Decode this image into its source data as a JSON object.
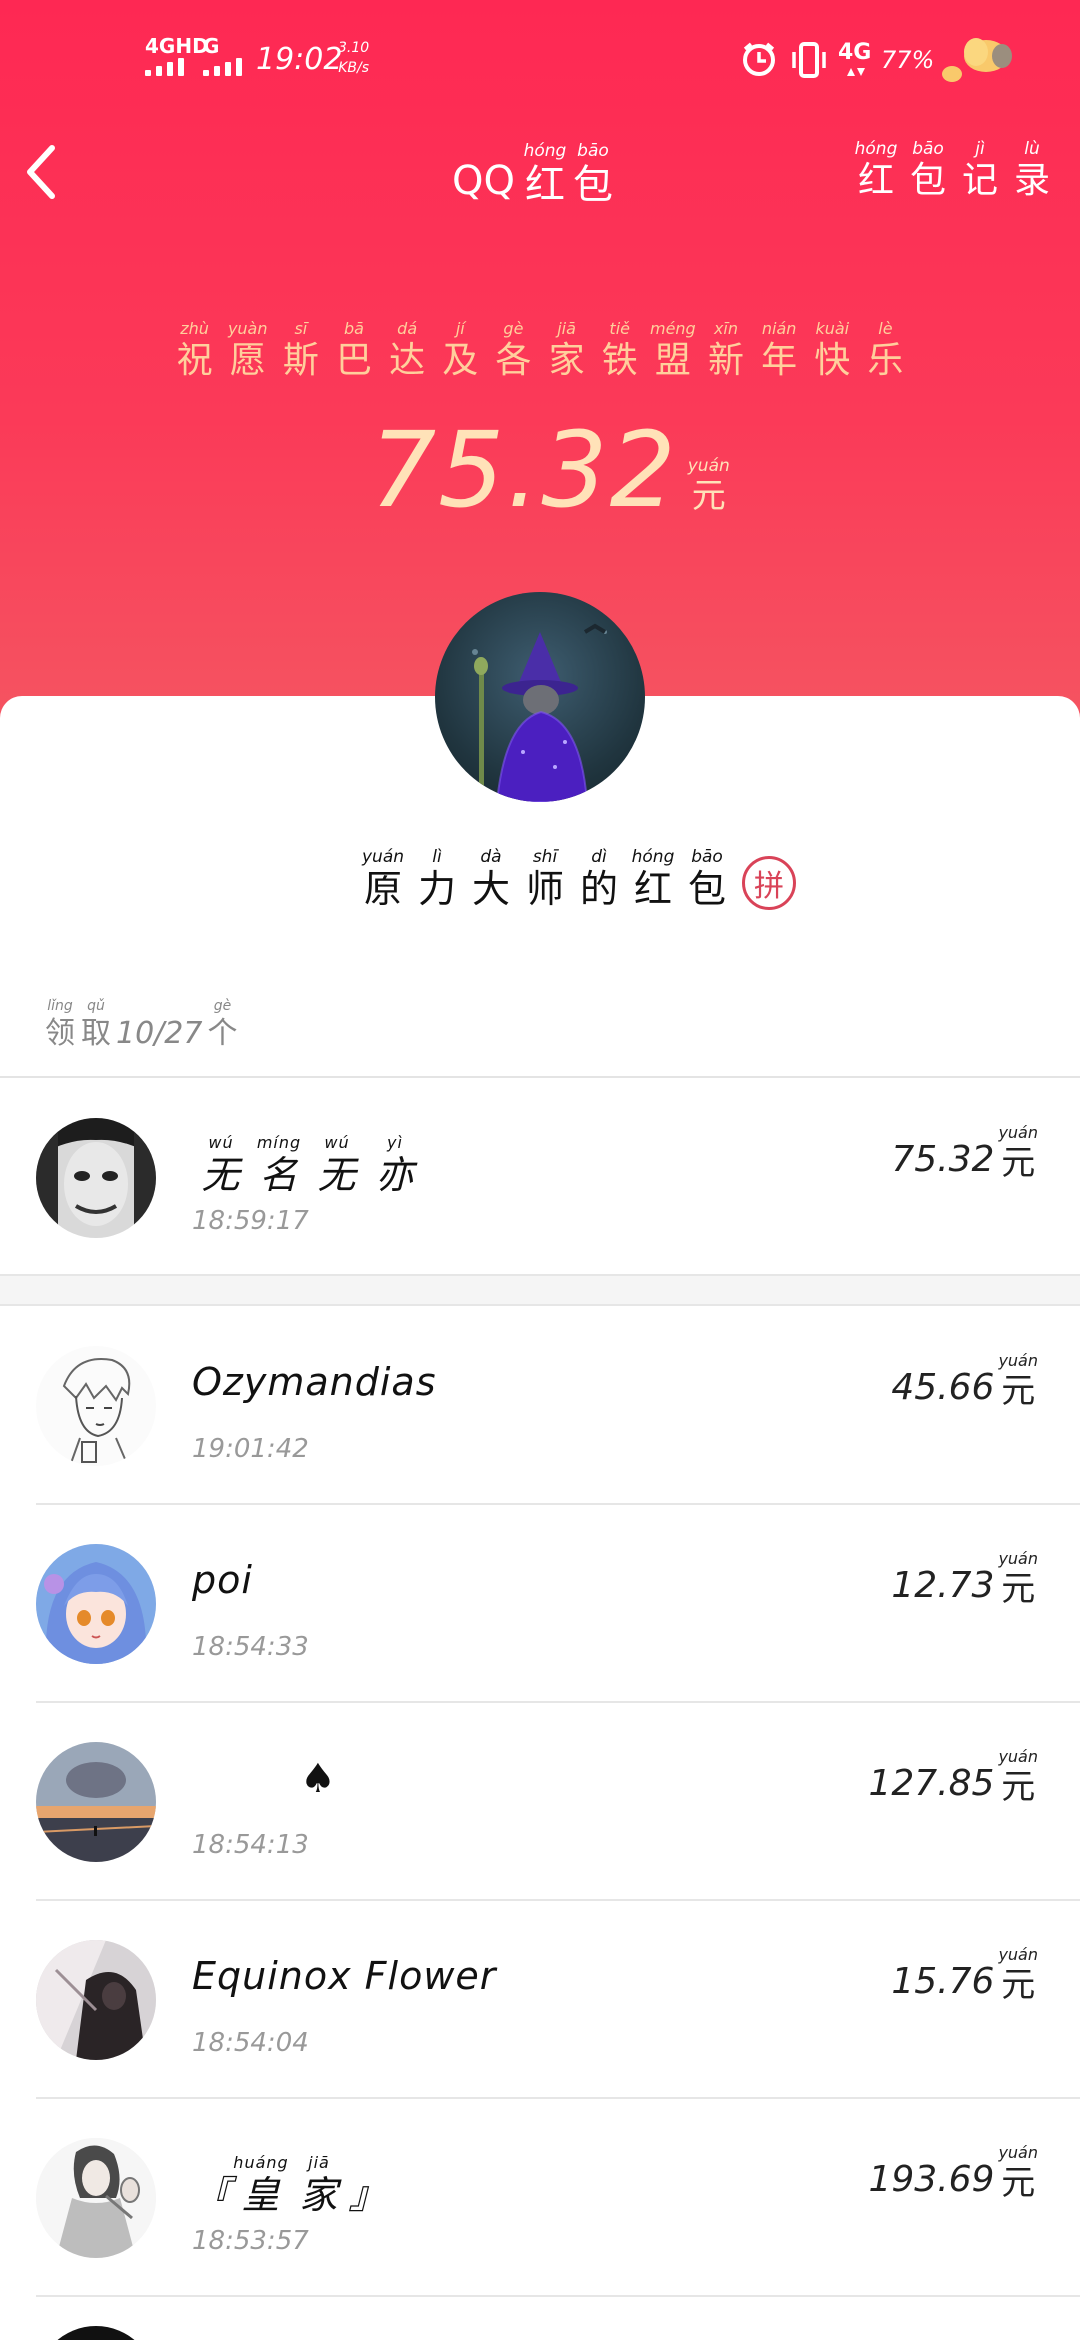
{
  "status_bar": {
    "net1": "4GHD",
    "net2": "G",
    "time": "19:02",
    "rate_value": "3.10",
    "rate_unit": "KB/s",
    "net3": "4G",
    "battery": "77%"
  },
  "header": {
    "title_prefix": "QQ",
    "title": [
      {
        "py": "hóng",
        "hz": "红"
      },
      {
        "py": "bāo",
        "hz": "包"
      }
    ],
    "records": [
      {
        "py": "hóng",
        "hz": "红"
      },
      {
        "py": "bāo",
        "hz": "包"
      },
      {
        "py": "jì",
        "hz": "记"
      },
      {
        "py": "lù",
        "hz": "录"
      }
    ]
  },
  "packet": {
    "wish": [
      {
        "py": "zhù",
        "hz": "祝"
      },
      {
        "py": "yuàn",
        "hz": "愿"
      },
      {
        "py": "sī",
        "hz": "斯"
      },
      {
        "py": "bā",
        "hz": "巴"
      },
      {
        "py": "dá",
        "hz": "达"
      },
      {
        "py": "jí",
        "hz": "及"
      },
      {
        "py": "gè",
        "hz": "各"
      },
      {
        "py": "jiā",
        "hz": "家"
      },
      {
        "py": "tiě",
        "hz": "铁"
      },
      {
        "py": "méng",
        "hz": "盟"
      },
      {
        "py": "xīn",
        "hz": "新"
      },
      {
        "py": "nián",
        "hz": "年"
      },
      {
        "py": "kuài",
        "hz": "快"
      },
      {
        "py": "lè",
        "hz": "乐"
      }
    ],
    "amount": "75.32",
    "unit": {
      "py": "yuán",
      "hz": "元"
    },
    "sender": [
      {
        "py": "yuán",
        "hz": "原"
      },
      {
        "py": "lì",
        "hz": "力"
      },
      {
        "py": "dà",
        "hz": "大"
      },
      {
        "py": "shī",
        "hz": "师"
      },
      {
        "py": "dì",
        "hz": "的"
      },
      {
        "py": "hóng",
        "hz": "红"
      },
      {
        "py": "bāo",
        "hz": "包"
      }
    ],
    "pin_badge": "拼",
    "claimed_prefix": [
      {
        "py": "lǐng",
        "hz": "领"
      },
      {
        "py": "qǔ",
        "hz": "取"
      }
    ],
    "claimed_count": "10/27",
    "claimed_suffix": [
      {
        "py": "gè",
        "hz": "个"
      }
    ]
  },
  "claims": [
    {
      "name": "",
      "name_ruby": [
        {
          "py": "wú",
          "hz": "无"
        },
        {
          "py": "míng",
          "hz": "名"
        },
        {
          "py": "wú",
          "hz": "无"
        },
        {
          "py": "yì",
          "hz": "亦"
        }
      ],
      "time": "18:59:17",
      "amount": "75.32"
    },
    {
      "name": "Ozymandias",
      "time": "19:01:42",
      "amount": "45.66"
    },
    {
      "name": "poi",
      "time": "18:54:33",
      "amount": "12.73"
    },
    {
      "name": "♠",
      "time": "18:54:13",
      "amount": "127.85"
    },
    {
      "name": "Equinox Flower",
      "time": "18:54:04",
      "amount": "15.76"
    },
    {
      "name": "",
      "name_ruby": [
        {
          "py": "",
          "hz": "『"
        },
        {
          "py": "huáng",
          "hz": "皇"
        },
        {
          "py": "jiā",
          "hz": "家"
        },
        {
          "py": "",
          "hz": "』"
        }
      ],
      "time": "18:53:57",
      "amount": "193.69"
    }
  ],
  "money_unit": {
    "py": "yuán",
    "hz": "元"
  },
  "colors": {
    "header": "#fe2853",
    "wish": "#ffcf9c",
    "amount": "#ffe2b8",
    "pin": "#d94358"
  },
  "icons": [
    "back-arrow-icon",
    "alarm-icon",
    "vibrate-icon",
    "pin-badge-icon"
  ]
}
